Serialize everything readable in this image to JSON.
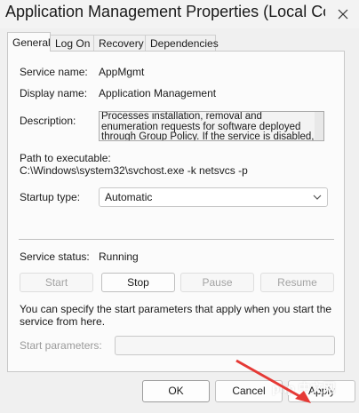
{
  "window": {
    "title": "Application Management Properties (Local Comput…"
  },
  "tabs": [
    {
      "label": "General",
      "active": true
    },
    {
      "label": "Log On",
      "active": false
    },
    {
      "label": "Recovery",
      "active": false
    },
    {
      "label": "Dependencies",
      "active": false
    }
  ],
  "general": {
    "service_name_label": "Service name:",
    "service_name_value": "AppMgmt",
    "display_name_label": "Display name:",
    "display_name_value": "Application Management",
    "description_label": "Description:",
    "description_value": "Processes installation, removal and enumeration requests for software deployed through Group Policy. If the service is disabled, users will be unable",
    "path_label": "Path to executable:",
    "path_value": "C:\\Windows\\system32\\svchost.exe -k netsvcs -p",
    "startup_type_label": "Startup type:",
    "startup_type_value": "Automatic",
    "service_status_label": "Service status:",
    "service_status_value": "Running",
    "buttons": {
      "start": "Start",
      "stop": "Stop",
      "pause": "Pause",
      "resume": "Resume"
    },
    "help_text": "You can specify the start parameters that apply when you start the service from here.",
    "start_params_label": "Start parameters:",
    "start_params_value": ""
  },
  "footer": {
    "ok": "OK",
    "cancel": "Cancel",
    "apply": "Apply"
  },
  "watermark": {
    "text": "php 中文网"
  },
  "colors": {
    "annotation_arrow": "#e53935",
    "window_bg": "#f0f0f0",
    "panel_bg": "#fbfbfb"
  }
}
